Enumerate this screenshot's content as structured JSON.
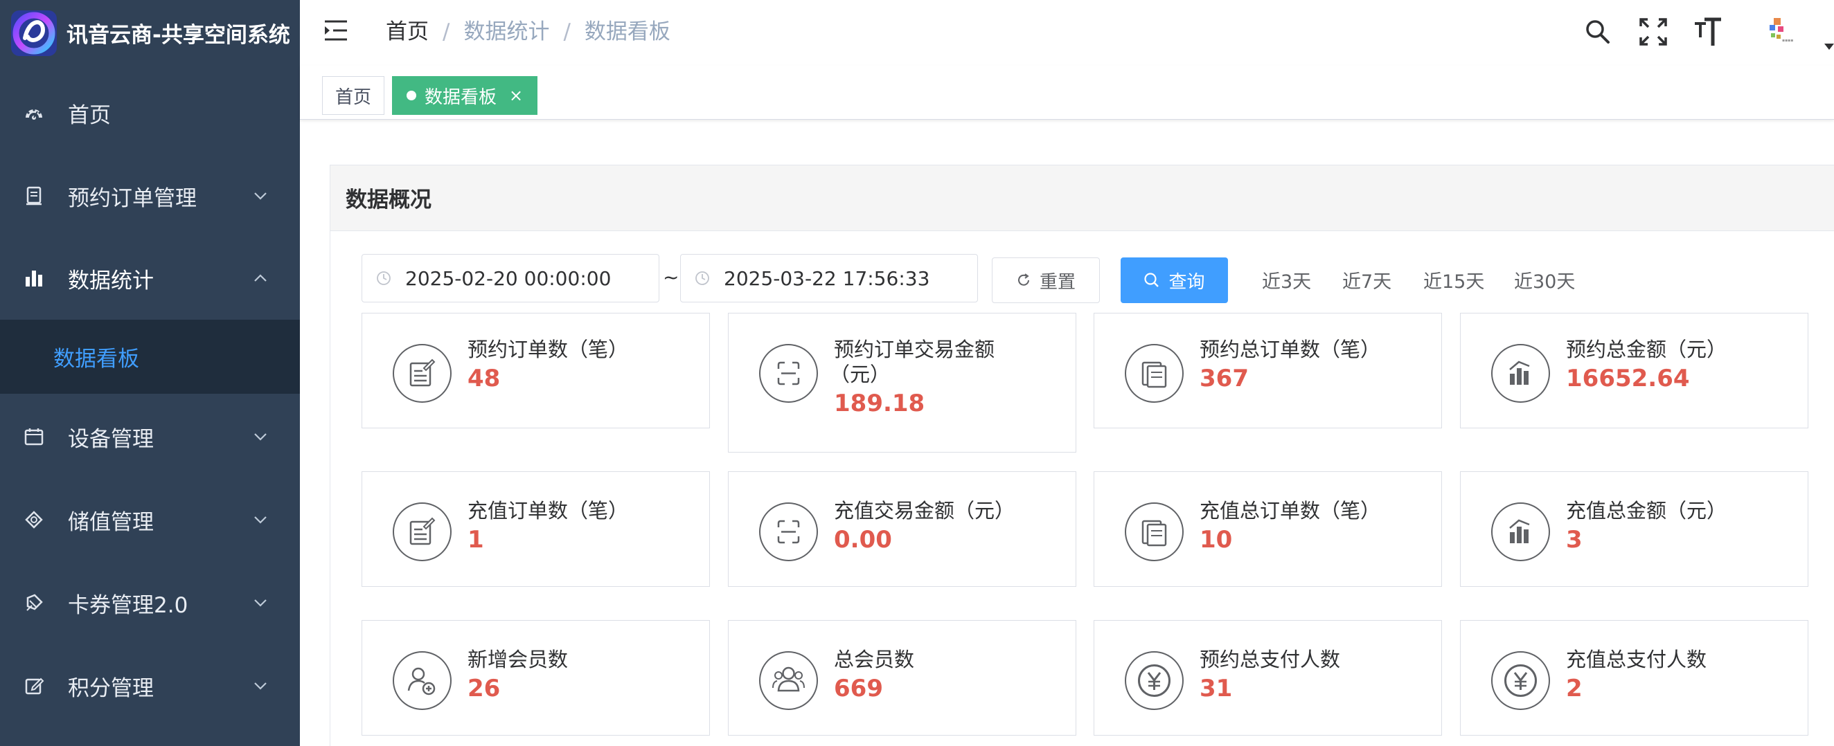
{
  "brand": {
    "title": "讯音云商-共享空间系统"
  },
  "sidebar": {
    "items": [
      {
        "label": "首页"
      },
      {
        "label": "预约订单管理"
      },
      {
        "label": "数据统计"
      },
      {
        "label": "设备管理"
      },
      {
        "label": "储值管理"
      },
      {
        "label": "卡券管理2.0"
      },
      {
        "label": "积分管理"
      }
    ],
    "active_sub": {
      "label": "数据看板"
    }
  },
  "breadcrumb": {
    "home": "首页",
    "level2": "数据统计",
    "level3": "数据看板",
    "sep": "/"
  },
  "tags": {
    "home": "首页",
    "active": "数据看板",
    "close": "×"
  },
  "panel": {
    "title": "数据概况",
    "start_date": "2025-02-20 00:00:00",
    "end_date": "2025-03-22 17:56:33",
    "range_separator": "~",
    "reset_label": "重置",
    "search_label": "查询",
    "quick": [
      "近3天",
      "近7天",
      "近15天",
      "近30天"
    ]
  },
  "cards": [
    {
      "label": "预约订单数（笔）",
      "value": "48",
      "icon": "edit-document-icon"
    },
    {
      "label": "预约订单交易金额（元）",
      "value": "189.18",
      "icon": "scan-icon"
    },
    {
      "label": "预约总订单数（笔）",
      "value": "367",
      "icon": "document-copy-icon"
    },
    {
      "label": "预约总金额（元）",
      "value": "16652.64",
      "icon": "bar-chart-icon"
    },
    {
      "label": "充值订单数（笔）",
      "value": "1",
      "icon": "edit-document-icon"
    },
    {
      "label": "充值交易金额（元）",
      "value": "0.00",
      "icon": "scan-icon"
    },
    {
      "label": "充值总订单数（笔）",
      "value": "10",
      "icon": "document-copy-icon"
    },
    {
      "label": "充值总金额（元）",
      "value": "3",
      "icon": "bar-chart-icon"
    },
    {
      "label": "新增会员数",
      "value": "26",
      "icon": "add-user-icon"
    },
    {
      "label": "总会员数",
      "value": "669",
      "icon": "users-icon"
    },
    {
      "label": "预约总支付人数",
      "value": "31",
      "icon": "yen-icon"
    },
    {
      "label": "充值总支付人数",
      "value": "2",
      "icon": "yen-icon"
    }
  ],
  "colors": {
    "sidebar_bg": "#304156",
    "active_text": "#409eff",
    "tag_active": "#42b983",
    "value_red": "#e05a4e",
    "primary": "#409eff"
  }
}
